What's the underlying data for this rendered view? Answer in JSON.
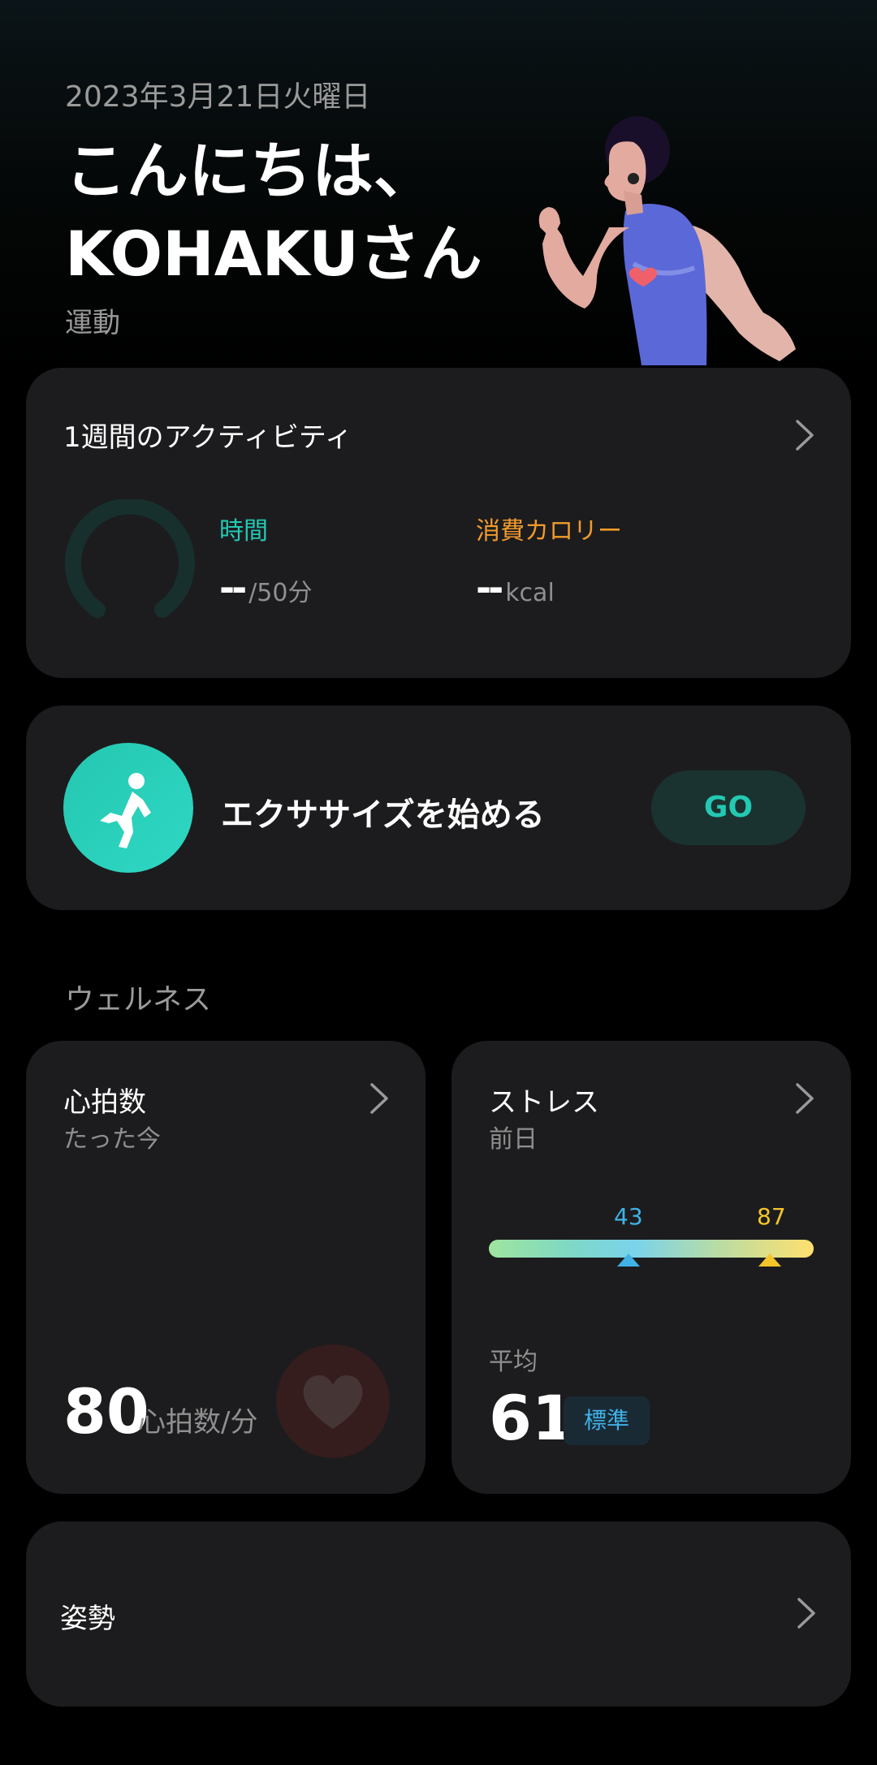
{
  "header": {
    "date": "2023年3月21日火曜日",
    "greeting_line1": "こんにちは、",
    "greeting_line2": "KOHAKUさん",
    "subtitle": "運動"
  },
  "activity": {
    "title": "1週間のアクティビティ",
    "time_label": "時間",
    "time_value": "--",
    "time_unit": "/50分",
    "calorie_label": "消費カロリー",
    "calorie_value": "--",
    "calorie_unit": "kcal",
    "colors": {
      "time": "#23c9b3",
      "calorie": "#f09a2c",
      "ring": "#17302d"
    }
  },
  "exercise": {
    "label": "エクササイズを始める",
    "go_label": "GO"
  },
  "wellness": {
    "section_title": "ウェルネス",
    "heart_rate": {
      "title": "心拍数",
      "subtitle": "たった今",
      "value": "80",
      "unit": "心拍数/分"
    },
    "stress": {
      "title": "ストレス",
      "subtitle": "前日",
      "min_value": "43",
      "max_value": "87",
      "avg_label": "平均",
      "avg_value": "61",
      "status": "標準",
      "colors": {
        "min": "#3fb2e6",
        "max": "#f5c52a"
      }
    }
  },
  "posture": {
    "title": "姿勢"
  }
}
